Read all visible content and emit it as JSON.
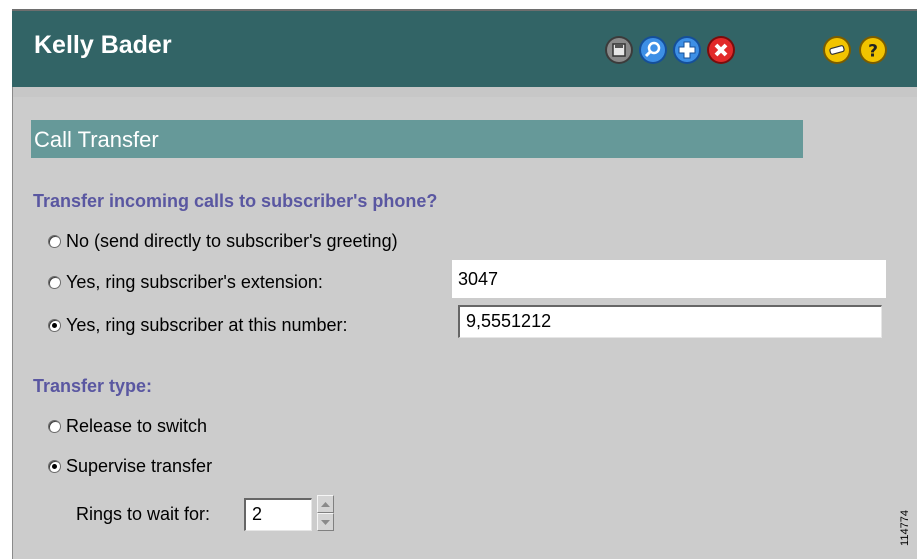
{
  "header": {
    "title": "Kelly Bader",
    "toolbar": [
      {
        "name": "save-icon",
        "color": "#6f6f6f"
      },
      {
        "name": "search-icon",
        "color": "#2f7fd6"
      },
      {
        "name": "add-icon",
        "color": "#2f7fd6"
      },
      {
        "name": "delete-icon",
        "color": "#d81b1b"
      },
      {
        "name": "minus-icon",
        "color": "#f0c000"
      },
      {
        "name": "help-icon",
        "color": "#f0c000"
      }
    ]
  },
  "section": {
    "title": "Call Transfer"
  },
  "transfer_question": "Transfer incoming calls to subscriber's phone?",
  "transfer_options": [
    {
      "label": "No (send directly to subscriber's greeting)",
      "checked": false
    },
    {
      "label": "Yes, ring subscriber's extension:",
      "checked": false
    },
    {
      "label": "Yes, ring subscriber at this number:",
      "checked": true
    }
  ],
  "extension_value": "3047",
  "number_value": "9,5551212",
  "transfer_type_label": "Transfer type:",
  "transfer_type_options": [
    {
      "label": "Release to switch",
      "checked": false
    },
    {
      "label": "Supervise transfer",
      "checked": true
    }
  ],
  "rings": {
    "label": "Rings to wait for:",
    "value": "2"
  },
  "figure_id": "114774"
}
